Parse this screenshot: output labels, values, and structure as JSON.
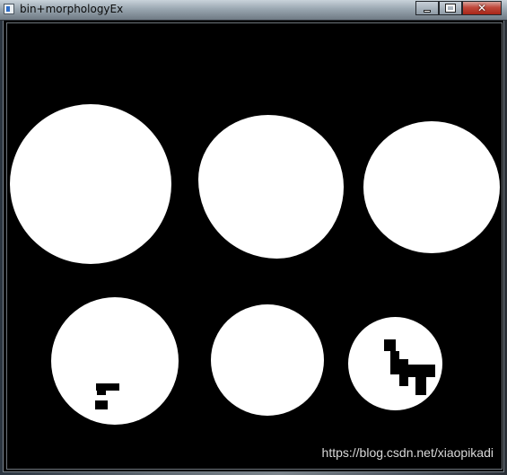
{
  "window": {
    "title": "bin+morphologyEx",
    "controls": {
      "minimize_icon": "minimize-icon",
      "maximize_icon": "maximize-icon",
      "close_icon": "close-icon",
      "close_label": "✕"
    }
  },
  "image": {
    "watermark": "https://blog.csdn.net/xiaopikadi",
    "background_color": "#000000",
    "foreground_color": "#ffffff"
  }
}
